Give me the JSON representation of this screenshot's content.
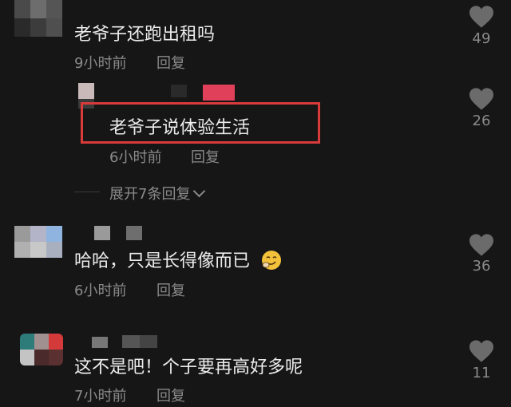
{
  "comments": [
    {
      "text": "老爷子还跑出租吗",
      "time": "9小时前",
      "reply_label": "回复",
      "likes": "49"
    },
    {
      "text": "老爷子说体验生活",
      "time": "6小时前",
      "reply_label": "回复",
      "likes": "26",
      "is_reply": true,
      "highlighted": true
    },
    {
      "text": "哈哈，只是长得像而已",
      "emoji": "smirk-emoji",
      "time": "6小时前",
      "reply_label": "回复",
      "likes": "36"
    },
    {
      "text": "这不是吧！个子要再高好多呢",
      "time": "7小时前",
      "reply_label": "回复",
      "likes": "11"
    }
  ],
  "expand_replies": {
    "label": "展开7条回复",
    "icon": "chevron-down-icon"
  },
  "colors": {
    "background": "#161616",
    "highlight_border": "#d93a3a",
    "meta_text": "#8a8a8a",
    "heart": "#6b6b6b"
  }
}
